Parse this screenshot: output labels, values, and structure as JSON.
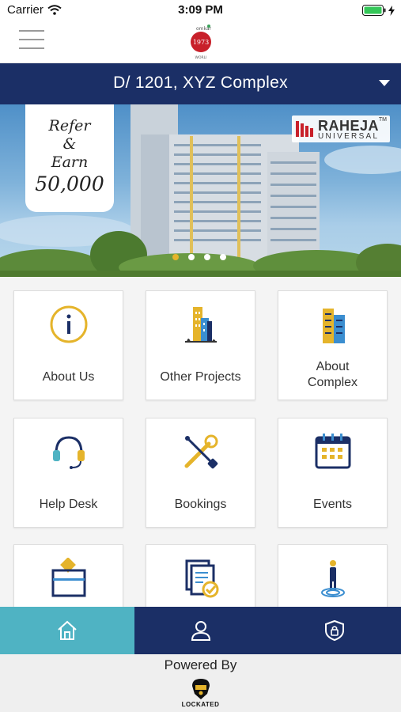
{
  "status_bar": {
    "carrier": "Carrier",
    "time": "3:09 PM"
  },
  "header": {
    "logo_name": "omkar-1973-worli-logo",
    "logo_small": "omkar",
    "logo_big": "1973",
    "logo_sub": "WORLI"
  },
  "unit_selector": {
    "label": "D/ 1201, XYZ Complex"
  },
  "banner": {
    "refer_words": [
      "Refer",
      "&",
      "Earn"
    ],
    "refer_amount": "50,000",
    "brand_name": "RAHEJA",
    "brand_sub": "UNIVERSAL",
    "brand_tm": "TM",
    "slides": 4,
    "active_slide": 1
  },
  "tiles": [
    {
      "label": "About Us",
      "icon": "info-icon"
    },
    {
      "label": "Other Projects",
      "icon": "buildings-icon"
    },
    {
      "label": "About\nComplex",
      "icon": "tower-icon"
    },
    {
      "label": "Help Desk",
      "icon": "headset-icon"
    },
    {
      "label": "Bookings",
      "icon": "tools-icon"
    },
    {
      "label": "Events",
      "icon": "calendar-icon"
    },
    {
      "label": "",
      "icon": "ballot-box-icon"
    },
    {
      "label": "",
      "icon": "documents-check-icon"
    },
    {
      "label": "",
      "icon": "person-location-icon"
    }
  ],
  "tab_bar": [
    {
      "name": "home",
      "icon": "home-icon",
      "active": true
    },
    {
      "name": "profile",
      "icon": "user-icon",
      "active": false
    },
    {
      "name": "security",
      "icon": "shield-lock-icon",
      "active": false
    }
  ],
  "footer": {
    "powered_by": "Powered By",
    "brand": "LOCKATED"
  },
  "colors": {
    "navy": "#1b2f66",
    "teal": "#4fb3c3",
    "gold": "#e5b42b",
    "blue": "#3b8ed0"
  }
}
